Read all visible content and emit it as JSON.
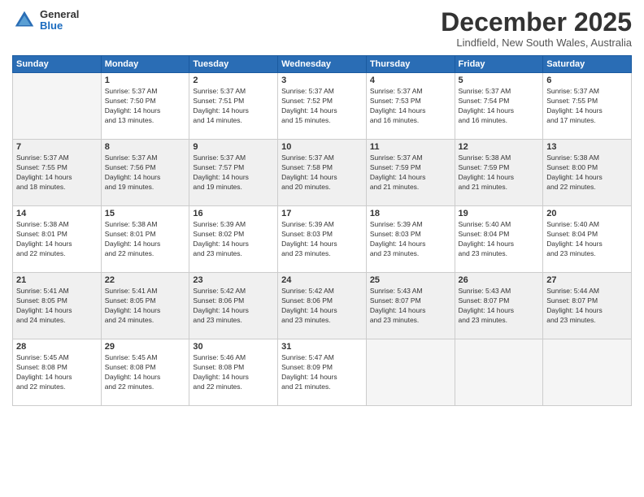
{
  "logo": {
    "general": "General",
    "blue": "Blue"
  },
  "title": "December 2025",
  "location": "Lindfield, New South Wales, Australia",
  "weekdays": [
    "Sunday",
    "Monday",
    "Tuesday",
    "Wednesday",
    "Thursday",
    "Friday",
    "Saturday"
  ],
  "weeks": [
    [
      {
        "day": "",
        "info": ""
      },
      {
        "day": "1",
        "info": "Sunrise: 5:37 AM\nSunset: 7:50 PM\nDaylight: 14 hours\nand 13 minutes."
      },
      {
        "day": "2",
        "info": "Sunrise: 5:37 AM\nSunset: 7:51 PM\nDaylight: 14 hours\nand 14 minutes."
      },
      {
        "day": "3",
        "info": "Sunrise: 5:37 AM\nSunset: 7:52 PM\nDaylight: 14 hours\nand 15 minutes."
      },
      {
        "day": "4",
        "info": "Sunrise: 5:37 AM\nSunset: 7:53 PM\nDaylight: 14 hours\nand 16 minutes."
      },
      {
        "day": "5",
        "info": "Sunrise: 5:37 AM\nSunset: 7:54 PM\nDaylight: 14 hours\nand 16 minutes."
      },
      {
        "day": "6",
        "info": "Sunrise: 5:37 AM\nSunset: 7:55 PM\nDaylight: 14 hours\nand 17 minutes."
      }
    ],
    [
      {
        "day": "7",
        "info": "Sunrise: 5:37 AM\nSunset: 7:55 PM\nDaylight: 14 hours\nand 18 minutes."
      },
      {
        "day": "8",
        "info": "Sunrise: 5:37 AM\nSunset: 7:56 PM\nDaylight: 14 hours\nand 19 minutes."
      },
      {
        "day": "9",
        "info": "Sunrise: 5:37 AM\nSunset: 7:57 PM\nDaylight: 14 hours\nand 19 minutes."
      },
      {
        "day": "10",
        "info": "Sunrise: 5:37 AM\nSunset: 7:58 PM\nDaylight: 14 hours\nand 20 minutes."
      },
      {
        "day": "11",
        "info": "Sunrise: 5:37 AM\nSunset: 7:59 PM\nDaylight: 14 hours\nand 21 minutes."
      },
      {
        "day": "12",
        "info": "Sunrise: 5:38 AM\nSunset: 7:59 PM\nDaylight: 14 hours\nand 21 minutes."
      },
      {
        "day": "13",
        "info": "Sunrise: 5:38 AM\nSunset: 8:00 PM\nDaylight: 14 hours\nand 22 minutes."
      }
    ],
    [
      {
        "day": "14",
        "info": "Sunrise: 5:38 AM\nSunset: 8:01 PM\nDaylight: 14 hours\nand 22 minutes."
      },
      {
        "day": "15",
        "info": "Sunrise: 5:38 AM\nSunset: 8:01 PM\nDaylight: 14 hours\nand 22 minutes."
      },
      {
        "day": "16",
        "info": "Sunrise: 5:39 AM\nSunset: 8:02 PM\nDaylight: 14 hours\nand 23 minutes."
      },
      {
        "day": "17",
        "info": "Sunrise: 5:39 AM\nSunset: 8:03 PM\nDaylight: 14 hours\nand 23 minutes."
      },
      {
        "day": "18",
        "info": "Sunrise: 5:39 AM\nSunset: 8:03 PM\nDaylight: 14 hours\nand 23 minutes."
      },
      {
        "day": "19",
        "info": "Sunrise: 5:40 AM\nSunset: 8:04 PM\nDaylight: 14 hours\nand 23 minutes."
      },
      {
        "day": "20",
        "info": "Sunrise: 5:40 AM\nSunset: 8:04 PM\nDaylight: 14 hours\nand 23 minutes."
      }
    ],
    [
      {
        "day": "21",
        "info": "Sunrise: 5:41 AM\nSunset: 8:05 PM\nDaylight: 14 hours\nand 24 minutes."
      },
      {
        "day": "22",
        "info": "Sunrise: 5:41 AM\nSunset: 8:05 PM\nDaylight: 14 hours\nand 24 minutes."
      },
      {
        "day": "23",
        "info": "Sunrise: 5:42 AM\nSunset: 8:06 PM\nDaylight: 14 hours\nand 23 minutes."
      },
      {
        "day": "24",
        "info": "Sunrise: 5:42 AM\nSunset: 8:06 PM\nDaylight: 14 hours\nand 23 minutes."
      },
      {
        "day": "25",
        "info": "Sunrise: 5:43 AM\nSunset: 8:07 PM\nDaylight: 14 hours\nand 23 minutes."
      },
      {
        "day": "26",
        "info": "Sunrise: 5:43 AM\nSunset: 8:07 PM\nDaylight: 14 hours\nand 23 minutes."
      },
      {
        "day": "27",
        "info": "Sunrise: 5:44 AM\nSunset: 8:07 PM\nDaylight: 14 hours\nand 23 minutes."
      }
    ],
    [
      {
        "day": "28",
        "info": "Sunrise: 5:45 AM\nSunset: 8:08 PM\nDaylight: 14 hours\nand 22 minutes."
      },
      {
        "day": "29",
        "info": "Sunrise: 5:45 AM\nSunset: 8:08 PM\nDaylight: 14 hours\nand 22 minutes."
      },
      {
        "day": "30",
        "info": "Sunrise: 5:46 AM\nSunset: 8:08 PM\nDaylight: 14 hours\nand 22 minutes."
      },
      {
        "day": "31",
        "info": "Sunrise: 5:47 AM\nSunset: 8:09 PM\nDaylight: 14 hours\nand 21 minutes."
      },
      {
        "day": "",
        "info": ""
      },
      {
        "day": "",
        "info": ""
      },
      {
        "day": "",
        "info": ""
      }
    ]
  ]
}
